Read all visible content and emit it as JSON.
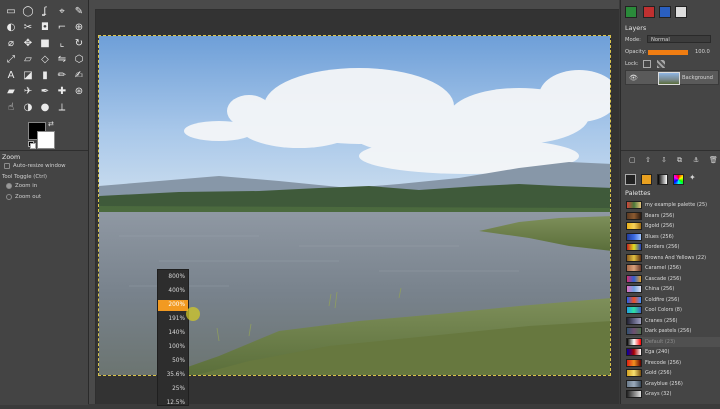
{
  "toolbox": {
    "tools": [
      {
        "name": "rect-select-icon",
        "glyph": "▭"
      },
      {
        "name": "ellipse-select-icon",
        "glyph": "◯"
      },
      {
        "name": "free-select-icon",
        "glyph": "ʆ"
      },
      {
        "name": "fuzzy-select-icon",
        "glyph": "⌖"
      },
      {
        "name": "paths-tool-icon",
        "glyph": "✎"
      },
      {
        "name": "color-select-icon",
        "glyph": "◐"
      },
      {
        "name": "scissors-icon",
        "glyph": "✂"
      },
      {
        "name": "foreground-select-icon",
        "glyph": "◘"
      },
      {
        "name": "color-picker-icon",
        "glyph": "⌐"
      },
      {
        "name": "zoom-tool-icon",
        "glyph": "⊕"
      },
      {
        "name": "measure-icon",
        "glyph": "⌀"
      },
      {
        "name": "move-tool-icon",
        "glyph": "✥"
      },
      {
        "name": "align-tool-icon",
        "glyph": "■"
      },
      {
        "name": "crop-tool-icon",
        "glyph": "⌞"
      },
      {
        "name": "rotate-tool-icon",
        "glyph": "↻"
      },
      {
        "name": "scale-tool-icon",
        "glyph": "⤢"
      },
      {
        "name": "shear-tool-icon",
        "glyph": "▱"
      },
      {
        "name": "perspective-icon",
        "glyph": "◇"
      },
      {
        "name": "flip-tool-icon",
        "glyph": "⇋"
      },
      {
        "name": "cage-tool-icon",
        "glyph": "⬡"
      },
      {
        "name": "text-tool-icon",
        "glyph": "A"
      },
      {
        "name": "bucket-fill-icon",
        "glyph": "◪"
      },
      {
        "name": "blend-tool-icon",
        "glyph": "▮"
      },
      {
        "name": "pencil-icon",
        "glyph": "✏"
      },
      {
        "name": "paintbrush-icon",
        "glyph": "✍"
      },
      {
        "name": "eraser-icon",
        "glyph": "▰"
      },
      {
        "name": "airbrush-icon",
        "glyph": "✈"
      },
      {
        "name": "ink-tool-icon",
        "glyph": "✒"
      },
      {
        "name": "heal-tool-icon",
        "glyph": "✚"
      },
      {
        "name": "clone-tool-icon",
        "glyph": "⊛"
      },
      {
        "name": "smudge-icon",
        "glyph": "☝"
      },
      {
        "name": "dodge-burn-icon",
        "glyph": "◑"
      },
      {
        "name": "blur-sharpen-icon",
        "glyph": "●"
      },
      {
        "name": "perspective-clone-icon",
        "glyph": "⟂"
      }
    ]
  },
  "zoom_options": {
    "title": "Zoom",
    "auto_resize": "Auto-resize window",
    "tool_toggle": "Tool Toggle  (Ctrl)",
    "zoom_in": "Zoom in",
    "zoom_out": "Zoom out"
  },
  "zoom_popup": {
    "items": [
      "800%",
      "400%",
      "200%",
      "191%",
      "140%",
      "100%",
      "50%",
      "35.6%",
      "25%",
      "12.5%"
    ],
    "selected_index": 2
  },
  "layers": {
    "title": "Layers",
    "mode_label": "Mode:",
    "mode_value": "Normal",
    "opacity_label": "Opacity:",
    "opacity_value": "100.0",
    "opacity_fraction": 1.0,
    "lock_label": "Lock:",
    "layer_name": "Background"
  },
  "palettes": {
    "title": "Palettes",
    "items": [
      {
        "label": "my example palette (25)",
        "colors": [
          "#d0453b",
          "#4a7a3a",
          "#e6c47a"
        ]
      },
      {
        "label": "Bears (256)",
        "colors": [
          "#5a3a22",
          "#8c5a30",
          "#2a1a10"
        ]
      },
      {
        "label": "Bgold (256)",
        "colors": [
          "#e9b018",
          "#f7d25a",
          "#a06c10"
        ]
      },
      {
        "label": "Blues (256)",
        "colors": [
          "#203a9a",
          "#3a6ae0",
          "#a0c4ff"
        ]
      },
      {
        "label": "Borders (256)",
        "colors": [
          "#c02020",
          "#e0e020",
          "#2040c0"
        ]
      },
      {
        "label": "Browns And Yellows (22)",
        "colors": [
          "#8a5a20",
          "#e0c040",
          "#603010"
        ]
      },
      {
        "label": "Caramel (256)",
        "colors": [
          "#a86a4a",
          "#d8a07a",
          "#6a3a2a"
        ]
      },
      {
        "label": "Cascade (256)",
        "colors": [
          "#d03070",
          "#3060d0",
          "#e0a030"
        ]
      },
      {
        "label": "China (256)",
        "colors": [
          "#e070c0",
          "#70a0e0",
          "#e0e0f0"
        ]
      },
      {
        "label": "Coldfire (256)",
        "colors": [
          "#2060f0",
          "#f05020",
          "#4090ff"
        ]
      },
      {
        "label": "Cool Colors (8)",
        "colors": [
          "#20a0e0",
          "#30e0a0",
          "#4060c0"
        ]
      },
      {
        "label": "Cranes (256)",
        "colors": [
          "#202030",
          "#606080",
          "#a0a0c0"
        ]
      },
      {
        "label": "Dark pastels (256)",
        "colors": [
          "#305070",
          "#705070",
          "#507050"
        ]
      },
      {
        "label": "Default (23)",
        "colors": [
          "#000000",
          "#ffffff",
          "#ff0000"
        ]
      },
      {
        "label": "Ega (240)",
        "colors": [
          "#0000aa",
          "#aa0000",
          "#ffffff"
        ]
      },
      {
        "label": "Firecode (256)",
        "colors": [
          "#e02010",
          "#f09020",
          "#600000"
        ]
      },
      {
        "label": "Gold (256)",
        "colors": [
          "#d4a020",
          "#f8e070",
          "#7a5010"
        ]
      },
      {
        "label": "Grayblue (256)",
        "colors": [
          "#6a7a8a",
          "#9aaabc",
          "#3a4a5a"
        ]
      },
      {
        "label": "Grays (32)",
        "colors": [
          "#202020",
          "#808080",
          "#e0e0e0"
        ]
      }
    ],
    "selected_index": 13
  },
  "colors": {
    "accent": "#f07d12",
    "panel": "#454545",
    "canvas_bg": "#333333"
  }
}
